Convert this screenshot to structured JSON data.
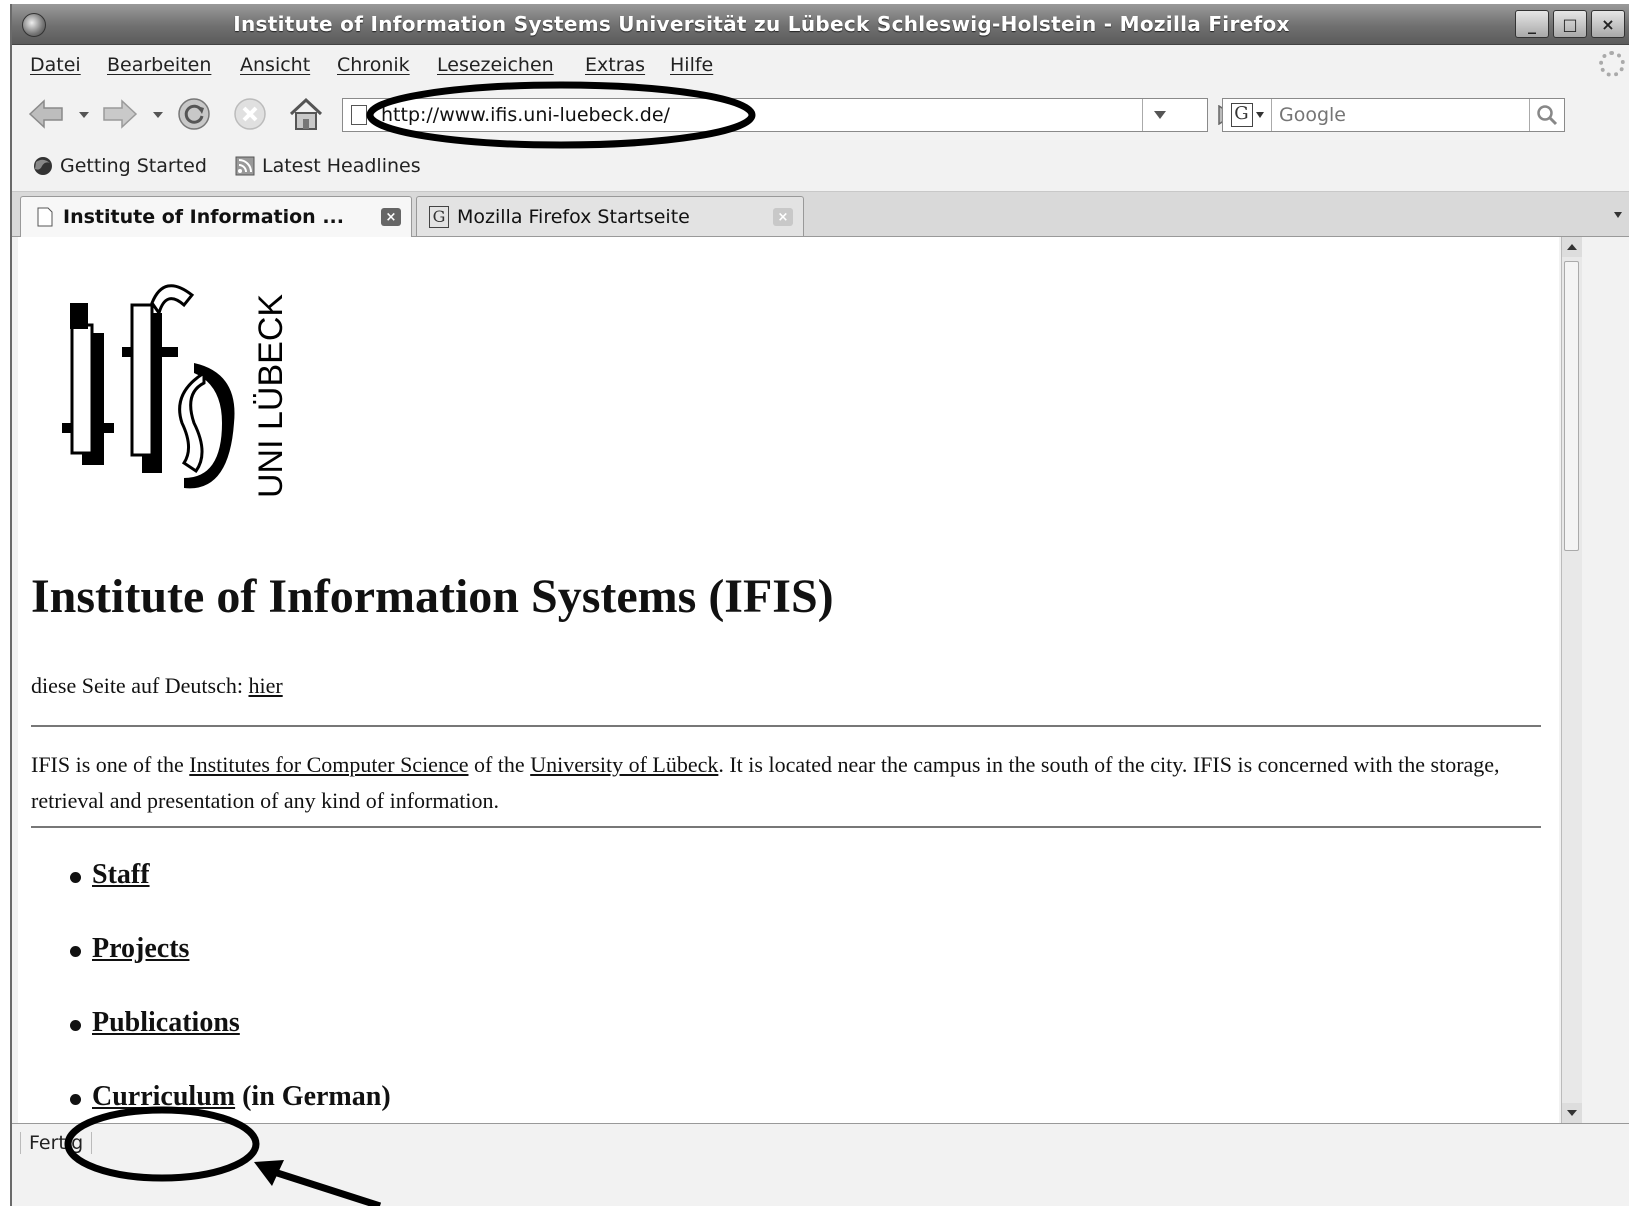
{
  "window": {
    "title": "Institute of Information Systems Universität zu Lübeck Schleswig-Holstein - Mozilla Firefox",
    "buttons": [
      "_",
      "□",
      "×"
    ]
  },
  "menubar": {
    "items": [
      "Datei",
      "Bearbeiten",
      "Ansicht",
      "Chronik",
      "Lesezeichen",
      "Extras",
      "Hilfe"
    ]
  },
  "navbar": {
    "url": "http://www.ifis.uni-luebeck.de/",
    "search_placeholder": "Google"
  },
  "bookmarks": {
    "items": [
      "Getting Started",
      "Latest Headlines"
    ]
  },
  "tabs": [
    {
      "label": "Institute of Information ...",
      "active": true
    },
    {
      "label": "Mozilla Firefox Startseite",
      "active": false
    }
  ],
  "page": {
    "logo_text": "UNI LÜBECK",
    "heading": "Institute of Information Systems (IFIS)",
    "german_prefix": "diese Seite auf Deutsch: ",
    "german_link": "hier",
    "desc_part1": "IFIS is one of the ",
    "desc_link1": "Institutes for Computer Science",
    "desc_part2": " of the ",
    "desc_link2": "University of Lübeck",
    "desc_part3": ". It is located near the campus in the south of the city. IFIS is concerned with the storage, retrieval and presentation of any kind of information.",
    "nav_links": {
      "staff": "Staff",
      "projects": "Projects",
      "publications": "Publications",
      "curriculum": "Curriculum",
      "curriculum_suffix": " (in German)"
    }
  },
  "statusbar": {
    "text": "Fertig"
  },
  "colors": {
    "titlebar": "#707070",
    "chrome": "#f2f2f2",
    "annotation": "#000000"
  }
}
